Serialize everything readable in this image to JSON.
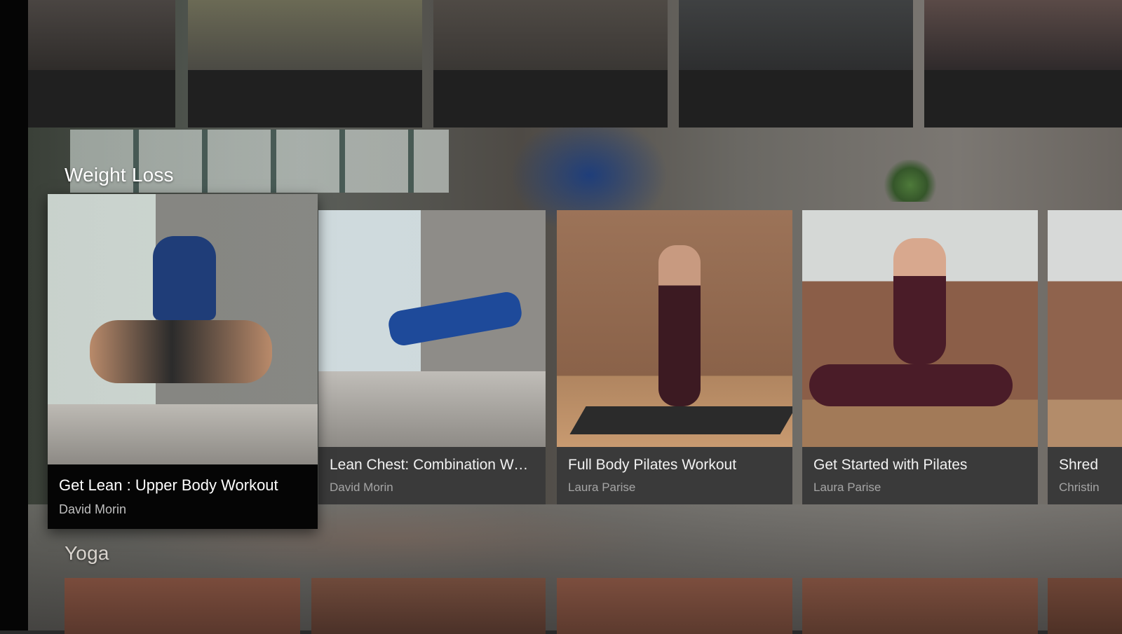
{
  "rows": {
    "weight_loss": {
      "title": "Weight Loss",
      "cards": [
        {
          "title": "Get Lean : Upper Body Workout",
          "author": "David Morin"
        },
        {
          "title": "Lean Chest: Combination Work...",
          "author": "David Morin"
        },
        {
          "title": "Full Body Pilates Workout",
          "author": "Laura Parise"
        },
        {
          "title": "Get Started with Pilates",
          "author": "Laura Parise"
        },
        {
          "title": "Shred",
          "author": "Christin"
        }
      ]
    },
    "yoga": {
      "title": "Yoga"
    }
  },
  "colors": {
    "focused_card_bg": "#050505",
    "card_info_bg": "#3a3a3a",
    "author_text": "#a5a5a5"
  }
}
